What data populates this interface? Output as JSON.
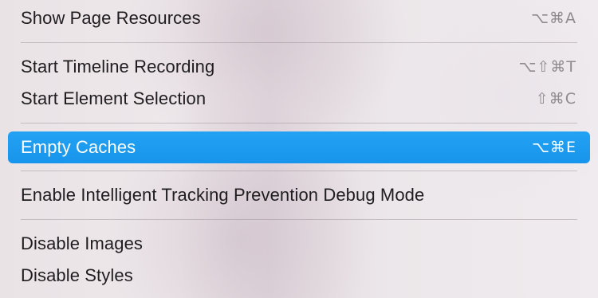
{
  "menu": {
    "items": [
      {
        "label": "Show Page Resources",
        "shortcut": "⌥⌘A"
      },
      {
        "label": "Start Timeline Recording",
        "shortcut": "⌥⇧⌘T"
      },
      {
        "label": "Start Element Selection",
        "shortcut": "⇧⌘C"
      },
      {
        "label": "Empty Caches",
        "shortcut": "⌥⌘E",
        "selected": true
      },
      {
        "label": "Enable Intelligent Tracking Prevention Debug Mode",
        "shortcut": ""
      },
      {
        "label": "Disable Images",
        "shortcut": ""
      },
      {
        "label": "Disable Styles",
        "shortcut": ""
      }
    ]
  },
  "colors": {
    "selection": "#1a9bf0",
    "text": "#1f1d1f",
    "shortcut": "#8e8a8e"
  }
}
